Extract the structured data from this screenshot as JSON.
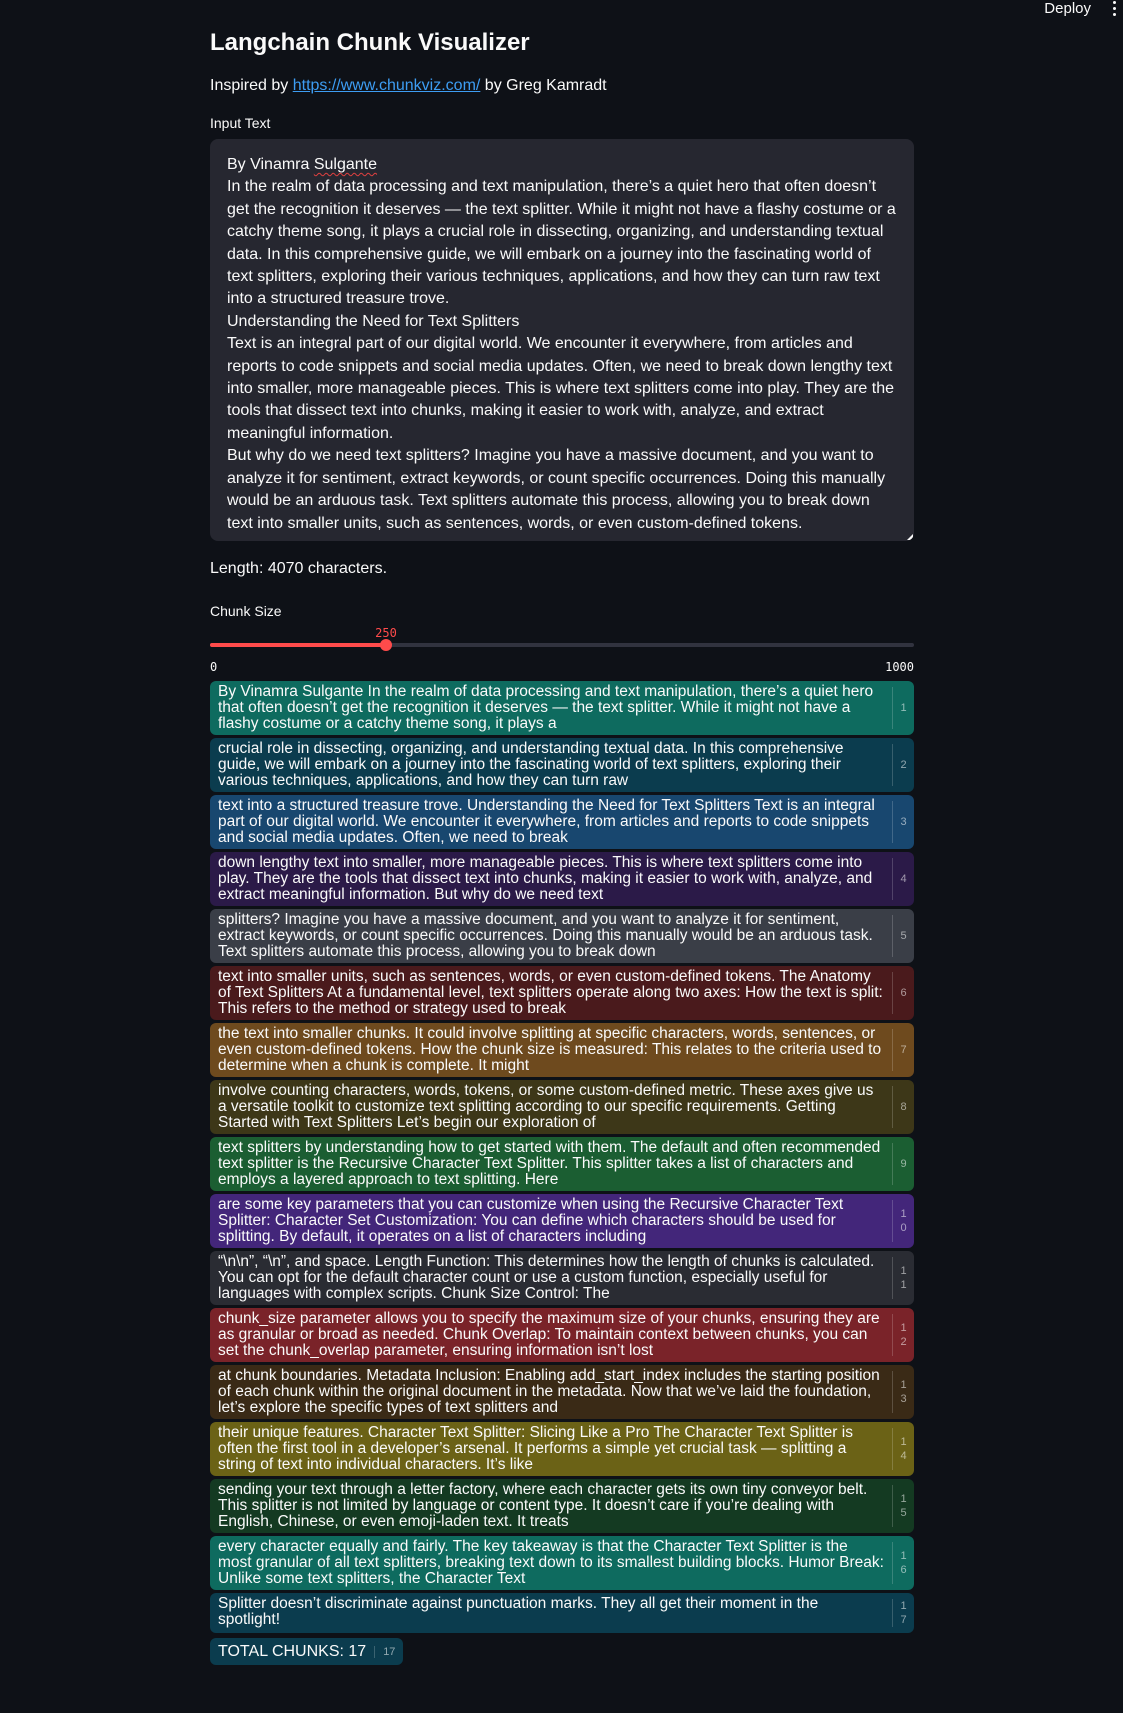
{
  "header": {
    "deploy_label": "Deploy",
    "menu_icon": "kebab-menu-icon"
  },
  "page": {
    "title": "Langchain Chunk Visualizer",
    "inspired_prefix": "Inspired by",
    "inspired_link": "https://www.chunkviz.com/",
    "inspired_suffix": "by Greg Kamradt"
  },
  "input": {
    "label": "Input Text",
    "author_prefix": "By Vinamra ",
    "author_name": "Sulgante",
    "paragraphs": [
      "In the realm of data processing and text manipulation, there’s a quiet hero that often doesn’t get the recognition it deserves — the text splitter. While it might not have a flashy costume or a catchy theme song, it plays a crucial role in dissecting, organizing, and understanding textual data. In this comprehensive guide, we will embark on a journey into the fascinating world of text splitters, exploring their various techniques, applications, and how they can turn raw text into a structured treasure trove.",
      "Understanding the Need for Text Splitters",
      "Text is an integral part of our digital world. We encounter it everywhere, from articles and reports to code snippets and social media updates. Often, we need to break down lengthy text into smaller, more manageable pieces. This is where text splitters come into play. They are the tools that dissect text into chunks, making it easier to work with, analyze, and extract meaningful information.",
      "But why do we need text splitters? Imagine you have a massive document, and you want to analyze it for sentiment, extract keywords, or count specific occurrences. Doing this manually would be an arduous task. Text splitters automate this process, allowing you to break down text into smaller units, such as sentences, words, or even custom-defined tokens."
    ],
    "length_text": "Length: 4070 characters."
  },
  "slider": {
    "label": "Chunk Size",
    "value": 250,
    "value_text": "250",
    "min": 0,
    "min_text": "0",
    "max": 1000,
    "max_text": "1000",
    "color": "#ff4b4b"
  },
  "chunks": [
    {
      "num": "1",
      "color": "#0e6b5f",
      "text": "By Vinamra Sulgante In the realm of data processing and text manipulation, there’s a quiet hero that often doesn’t get the recognition it deserves — the text splitter. While it might not have a flashy costume or a catchy theme song, it plays a"
    },
    {
      "num": "2",
      "color": "#0b3c4e",
      "text": "crucial role in dissecting, organizing, and understanding textual data. In this comprehensive guide, we will embark on a journey into the fascinating world of text splitters, exploring their various techniques, applications, and how they can turn raw"
    },
    {
      "num": "3",
      "color": "#18476f",
      "text": "text into a structured treasure trove. Understanding the Need for Text Splitters Text is an integral part of our digital world. We encounter it everywhere, from articles and reports to code snippets and social media updates. Often, we need to break"
    },
    {
      "num": "4",
      "color": "#2b1a48",
      "text": "down lengthy text into smaller, more manageable pieces. This is where text splitters come into play. They are the tools that dissect text into chunks, making it easier to work with, analyze, and extract meaningful information. But why do we need text"
    },
    {
      "num": "5",
      "color": "#3a3e47",
      "text": "splitters? Imagine you have a massive document, and you want to analyze it for sentiment, extract keywords, or count specific occurrences. Doing this manually would be an arduous task. Text splitters automate this process, allowing you to break down"
    },
    {
      "num": "6",
      "color": "#4a1a1c",
      "text": "text into smaller units, such as sentences, words, or even custom-defined tokens. The Anatomy of Text Splitters At a fundamental level, text splitters operate along two axes: How the text is split: This refers to the method or strategy used to break"
    },
    {
      "num": "7",
      "color": "#6e4a1e",
      "text": "the text into smaller chunks. It could involve splitting at specific characters, words, sentences, or even custom-defined tokens. How the chunk size is measured: This relates to the criteria used to determine when a chunk is complete. It might"
    },
    {
      "num": "8",
      "color": "#3d3718",
      "text": "involve counting characters, words, tokens, or some custom-defined metric. These axes give us a versatile toolkit to customize text splitting according to our specific requirements. Getting Started with Text Splitters Let’s begin our exploration of"
    },
    {
      "num": "9",
      "color": "#1b5e32",
      "text": "text splitters by understanding how to get started with them. The default and often recommended text splitter is the Recursive Character Text Splitter. This splitter takes a list of characters and employs a layered approach to text splitting. Here"
    },
    {
      "num": "10",
      "color": "#43267a",
      "text": "are some key parameters that you can customize when using the Recursive Character Text Splitter: Character Set Customization: You can define which characters should be used for splitting. By default, it operates on a list of characters including"
    },
    {
      "num": "11",
      "color": "#2a2c33",
      "text": "“\\n\\n”, “\\n”, and space. Length Function: This determines how the length of chunks is calculated. You can opt for the default character count or use a custom function, especially useful for languages with complex scripts. Chunk Size Control: The"
    },
    {
      "num": "12",
      "color": "#7a2329",
      "text": "chunk_size parameter allows you to specify the maximum size of your chunks, ensuring they are as granular or broad as needed. Chunk Overlap: To maintain context between chunks, you can set the chunk_overlap parameter, ensuring information isn’t lost"
    },
    {
      "num": "13",
      "color": "#3a2a16",
      "text": "at chunk boundaries. Metadata Inclusion: Enabling add_start_index includes the starting position of each chunk within the original document in the metadata. Now that we’ve laid the foundation, let’s explore the specific types of text splitters and"
    },
    {
      "num": "14",
      "color": "#6b6216",
      "text": "their unique features. Character Text Splitter: Slicing Like a Pro The Character Text Splitter is often the first tool in a developer’s arsenal. It performs a simple yet crucial task — splitting a string of text into individual characters. It’s like"
    },
    {
      "num": "15",
      "color": "#143a22",
      "text": "sending your text through a letter factory, where each character gets its own tiny conveyor belt. This splitter is not limited by language or content type. It doesn’t care if you’re dealing with English, Chinese, or even emoji-laden text. It treats"
    },
    {
      "num": "16",
      "color": "#0e6b5f",
      "text": "every character equally and fairly. The key takeaway is that the Character Text Splitter is the most granular of all text splitters, breaking text down to its smallest building blocks. Humor Break: Unlike some text splitters, the Character Text"
    },
    {
      "num": "17",
      "color": "#0b3c4e",
      "text": "Splitter doesn’t discriminate against punctuation marks. They all get their moment in the spotlight!"
    }
  ],
  "total": {
    "label": "TOTAL CHUNKS: 17",
    "count": "17"
  }
}
